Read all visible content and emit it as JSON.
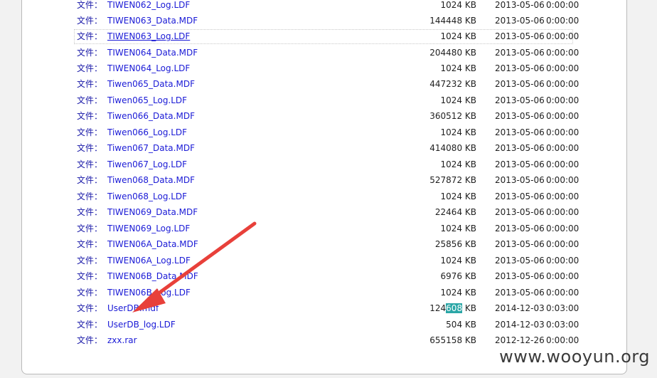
{
  "file_label": "文件：",
  "files": [
    {
      "name": "TIWEN062_Log.LDF",
      "size": "1024 KB",
      "date": "2013-05-06",
      "time": "0:00:00"
    },
    {
      "name": "TIWEN063_Data.MDF",
      "size": "144448 KB",
      "date": "2013-05-06",
      "time": "0:00:00"
    },
    {
      "name": "TIWEN063_Log.LDF",
      "size": "1024 KB",
      "date": "2013-05-06",
      "time": "0:00:00",
      "focused": true
    },
    {
      "name": "TIWEN064_Data.MDF",
      "size": "204480 KB",
      "date": "2013-05-06",
      "time": "0:00:00"
    },
    {
      "name": "TIWEN064_Log.LDF",
      "size": "1024 KB",
      "date": "2013-05-06",
      "time": "0:00:00"
    },
    {
      "name": "Tiwen065_Data.MDF",
      "size": "447232 KB",
      "date": "2013-05-06",
      "time": "0:00:00"
    },
    {
      "name": "Tiwen065_Log.LDF",
      "size": "1024 KB",
      "date": "2013-05-06",
      "time": "0:00:00"
    },
    {
      "name": "Tiwen066_Data.MDF",
      "size": "360512 KB",
      "date": "2013-05-06",
      "time": "0:00:00"
    },
    {
      "name": "Tiwen066_Log.LDF",
      "size": "1024 KB",
      "date": "2013-05-06",
      "time": "0:00:00"
    },
    {
      "name": "Tiwen067_Data.MDF",
      "size": "414080 KB",
      "date": "2013-05-06",
      "time": "0:00:00"
    },
    {
      "name": "Tiwen067_Log.LDF",
      "size": "1024 KB",
      "date": "2013-05-06",
      "time": "0:00:00"
    },
    {
      "name": "Tiwen068_Data.MDF",
      "size": "527872 KB",
      "date": "2013-05-06",
      "time": "0:00:00"
    },
    {
      "name": "Tiwen068_Log.LDF",
      "size": "1024 KB",
      "date": "2013-05-06",
      "time": "0:00:00"
    },
    {
      "name": "TIWEN069_Data.MDF",
      "size": "22464 KB",
      "date": "2013-05-06",
      "time": "0:00:00"
    },
    {
      "name": "TIWEN069_Log.LDF",
      "size": "1024 KB",
      "date": "2013-05-06",
      "time": "0:00:00"
    },
    {
      "name": "TIWEN06A_Data.MDF",
      "size": "25856 KB",
      "date": "2013-05-06",
      "time": "0:00:00"
    },
    {
      "name": "TIWEN06A_Log.LDF",
      "size": "1024 KB",
      "date": "2013-05-06",
      "time": "0:00:00"
    },
    {
      "name": "TIWEN06B_Data.MDF",
      "size": "6976 KB",
      "date": "2013-05-06",
      "time": "0:00:00"
    },
    {
      "name": "TIWEN06B_Log.LDF",
      "size": "1024 KB",
      "date": "2013-05-06",
      "time": "0:00:00"
    },
    {
      "name": "UserDB.mdf",
      "size_pre": "124",
      "size_hl": "608",
      "size_post": " KB",
      "date": "2014-12-03",
      "time": "0:03:00"
    },
    {
      "name": "UserDB_log.LDF",
      "size": "504 KB",
      "date": "2014-12-03",
      "time": "0:03:00"
    },
    {
      "name": "zxx.rar",
      "size": "655158 KB",
      "date": "2012-12-26",
      "time": "0:00:00"
    }
  ],
  "annotation": {
    "icon": "red-arrow-icon",
    "color": "#e8403a",
    "points_to": "UserDB.mdf"
  },
  "watermark": "www.wooyun.org"
}
